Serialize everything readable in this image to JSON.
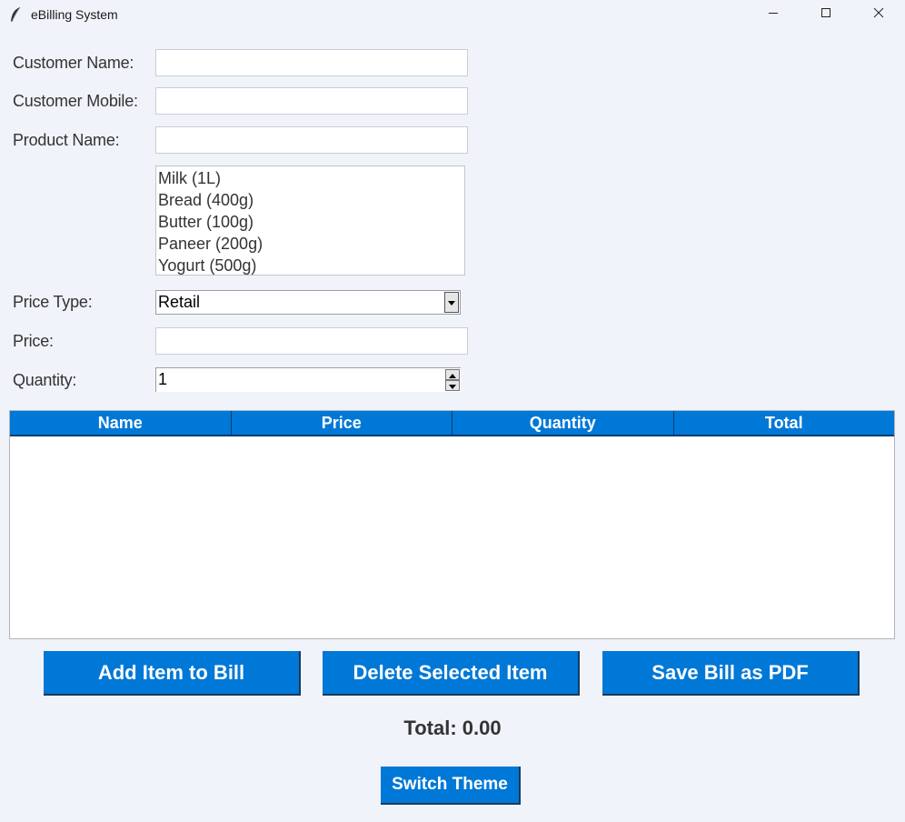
{
  "window": {
    "title": "eBilling System",
    "icon": "feather-icon"
  },
  "form": {
    "customer_name": {
      "label": "Customer Name:",
      "value": ""
    },
    "customer_mobile": {
      "label": "Customer Mobile:",
      "value": ""
    },
    "product_name": {
      "label": "Product Name:",
      "value": ""
    },
    "products": [
      "Milk (1L)",
      "Bread (400g)",
      "Butter (100g)",
      "Paneer (200g)",
      "Yogurt (500g)"
    ],
    "price_type": {
      "label": "Price Type:",
      "value": "Retail"
    },
    "price": {
      "label": "Price:",
      "value": ""
    },
    "quantity": {
      "label": "Quantity:",
      "value": "1"
    }
  },
  "table": {
    "columns": [
      "Name",
      "Price",
      "Quantity",
      "Total"
    ],
    "rows": []
  },
  "buttons": {
    "add": "Add Item to Bill",
    "delete": "Delete Selected Item",
    "save_pdf": "Save Bill as PDF",
    "switch_theme": "Switch Theme"
  },
  "total_text": "Total: 0.00",
  "colors": {
    "accent": "#0078d7",
    "background": "#f0f3f9"
  }
}
